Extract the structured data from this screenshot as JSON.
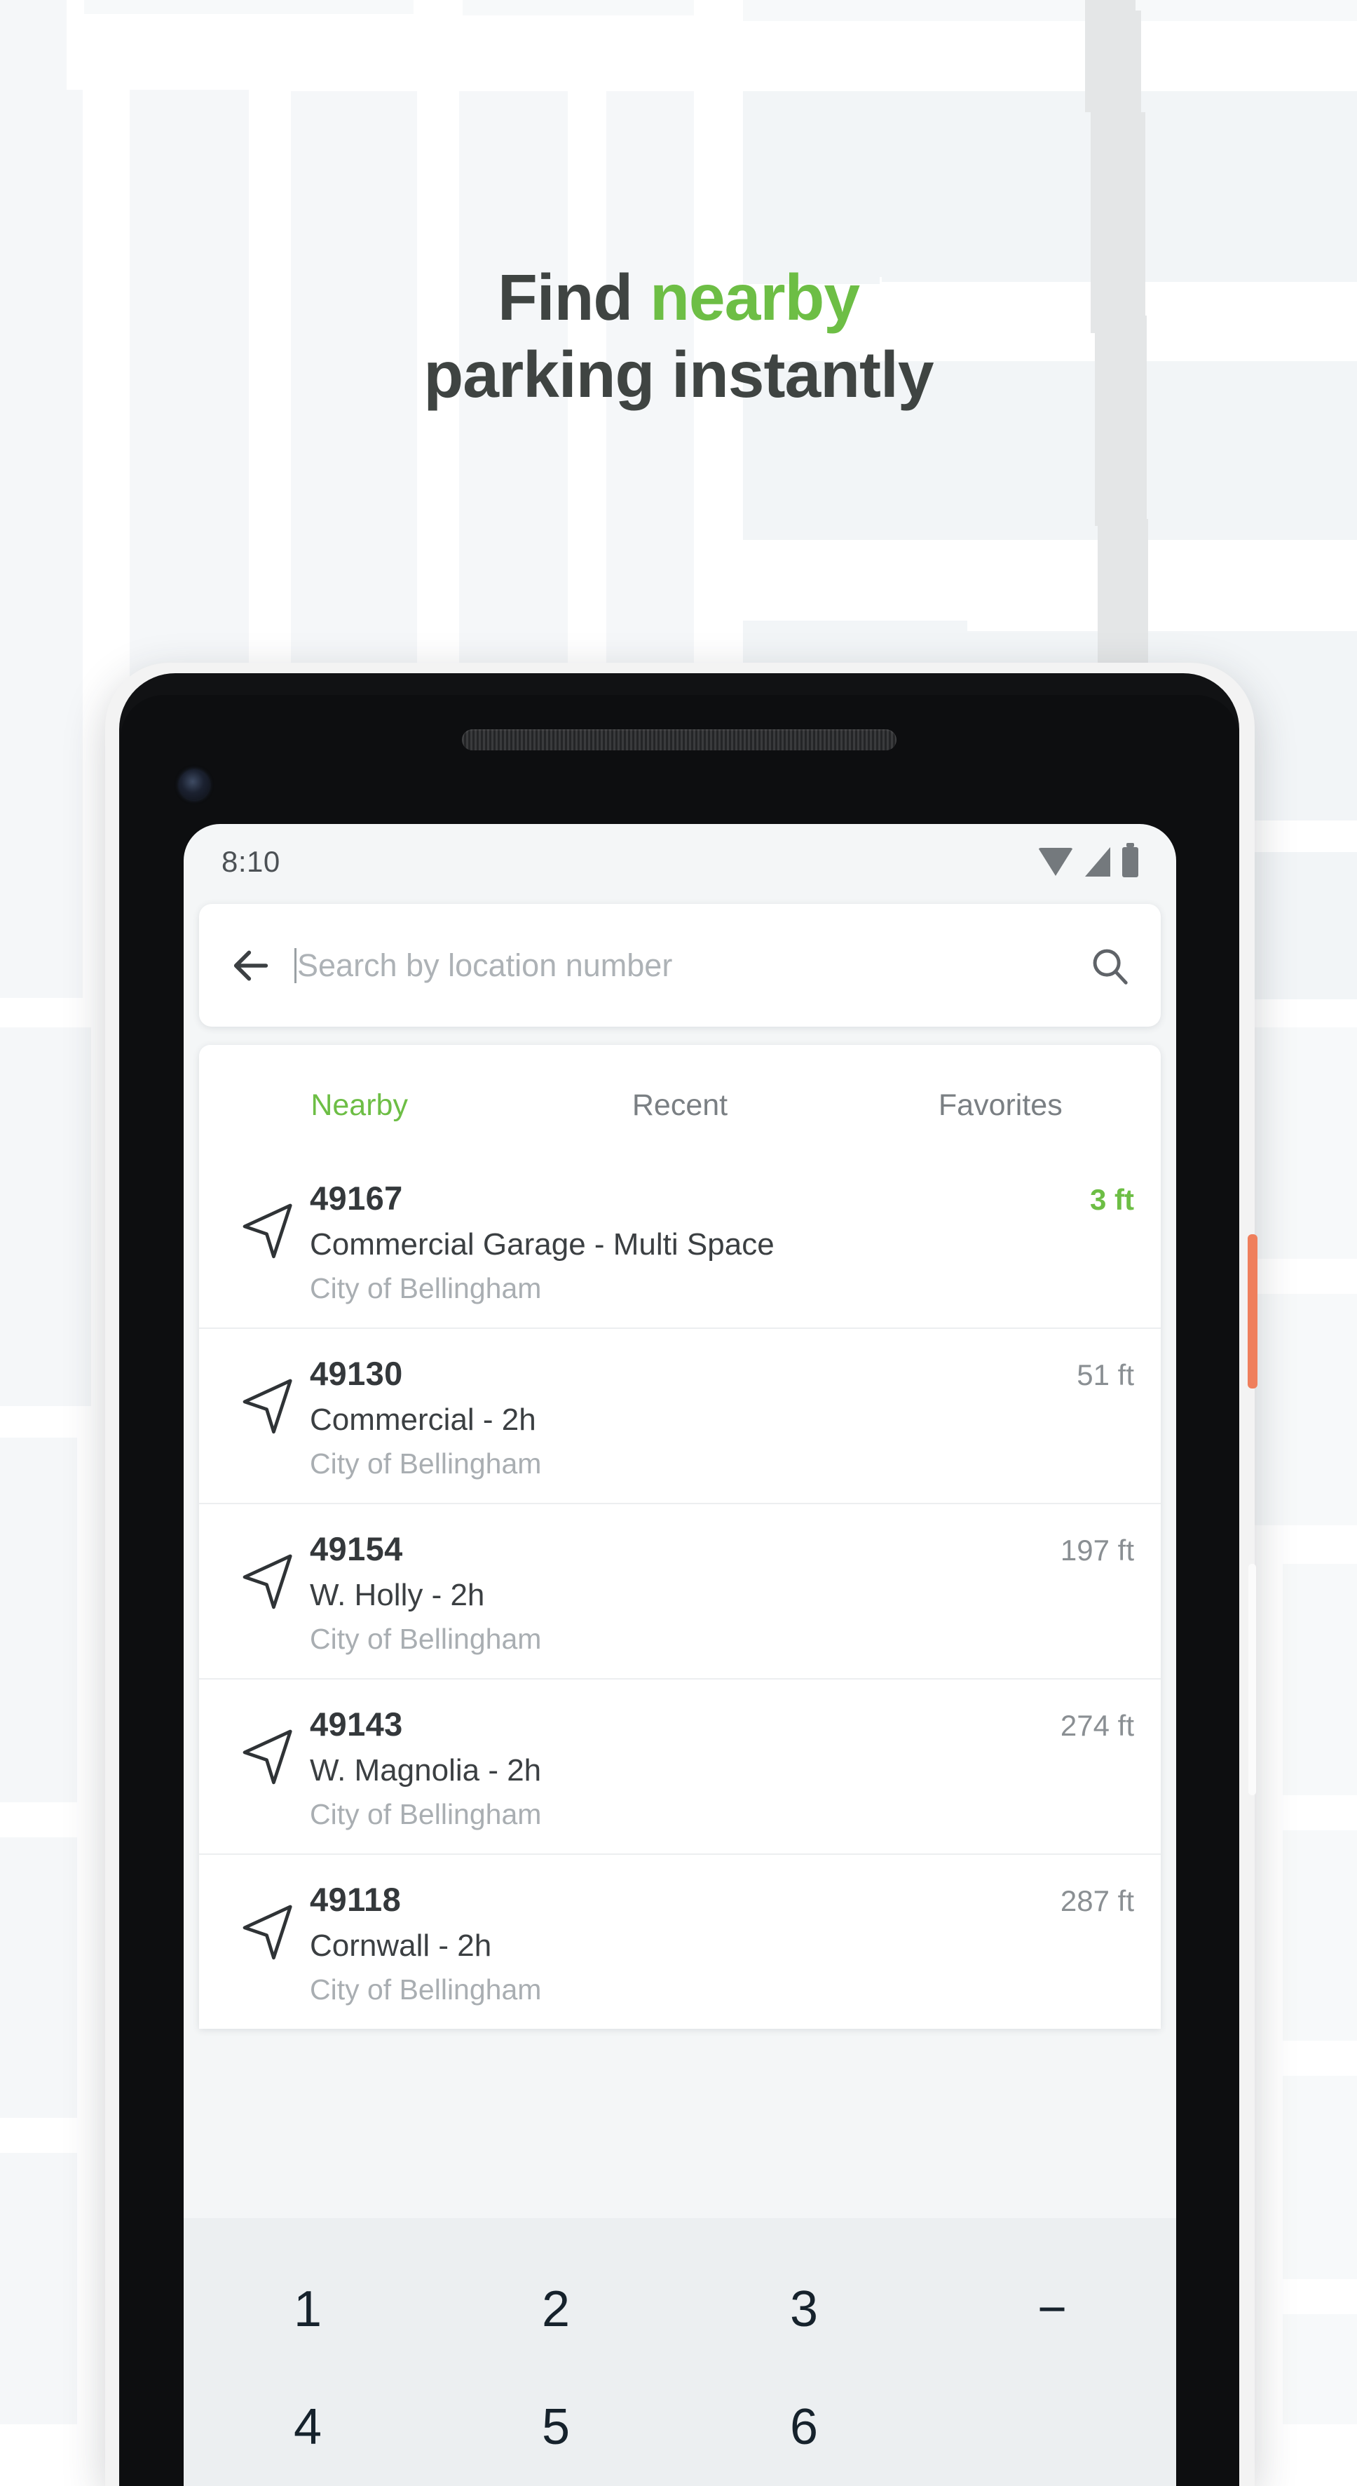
{
  "headline": {
    "line1_plain": "Find ",
    "line1_accent": "nearby",
    "line2": "parking instantly",
    "accent_color": "#6DBE45",
    "text_color": "#3f4442"
  },
  "phone": {
    "power_button_color": "#ef7f5c",
    "volume_button_color": "#fbfbfb"
  },
  "status_bar": {
    "time": "8:10",
    "icons": [
      "wifi-icon",
      "cell-signal-icon",
      "battery-icon"
    ]
  },
  "search": {
    "back_icon": "back-arrow-icon",
    "placeholder": "Search by location number",
    "value": "",
    "search_icon": "search-icon"
  },
  "tabs": [
    {
      "label": "Nearby",
      "active": true
    },
    {
      "label": "Recent",
      "active": false
    },
    {
      "label": "Favorites",
      "active": false
    }
  ],
  "results": [
    {
      "id": "49167",
      "description": "Commercial Garage - Multi Space",
      "operator": "City of Bellingham",
      "distance": "3 ft",
      "distance_highlighted": true
    },
    {
      "id": "49130",
      "description": "Commercial - 2h",
      "operator": "City of Bellingham",
      "distance": "51 ft",
      "distance_highlighted": false
    },
    {
      "id": "49154",
      "description": "W. Holly - 2h",
      "operator": "City of Bellingham",
      "distance": "197 ft",
      "distance_highlighted": false
    },
    {
      "id": "49143",
      "description": "W. Magnolia - 2h",
      "operator": "City of Bellingham",
      "distance": "274 ft",
      "distance_highlighted": false
    },
    {
      "id": "49118",
      "description": "Cornwall - 2h",
      "operator": "City of Bellingham",
      "distance": "287 ft",
      "distance_highlighted": false
    }
  ],
  "keyboard": {
    "rows": [
      [
        "1",
        "2",
        "3",
        "−"
      ],
      [
        "4",
        "5",
        "6",
        ""
      ]
    ]
  },
  "colors": {
    "accent_green": "#6DBE45",
    "map_block": "#f5f7f9",
    "map_road_gray": "#e4e6e7",
    "keyboard_bg": "#eceff1"
  }
}
